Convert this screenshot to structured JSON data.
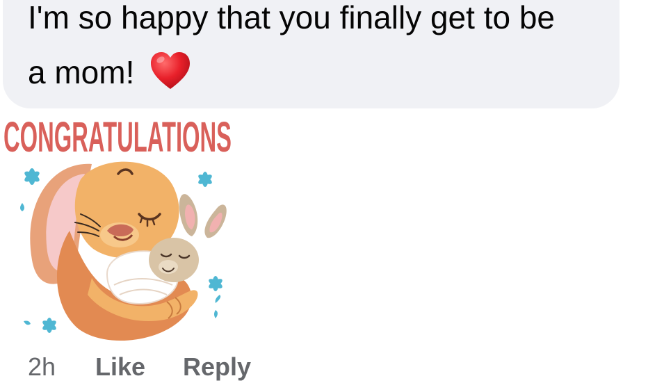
{
  "comment": {
    "text_line1": "I'm so happy that you finally get to be",
    "text_line2": "a mom!",
    "emoji": "heart-emoji",
    "bubble_color": "#f0f1f5"
  },
  "sticker": {
    "headline": "CONGRATULATIONS",
    "headline_color": "#d9605a",
    "accent_color": "#4fb7d3",
    "subject": "mother-bunny-hugging-baby-bunny"
  },
  "actions": {
    "timestamp": "2h",
    "like_label": "Like",
    "reply_label": "Reply",
    "meta_color": "#65676b"
  }
}
